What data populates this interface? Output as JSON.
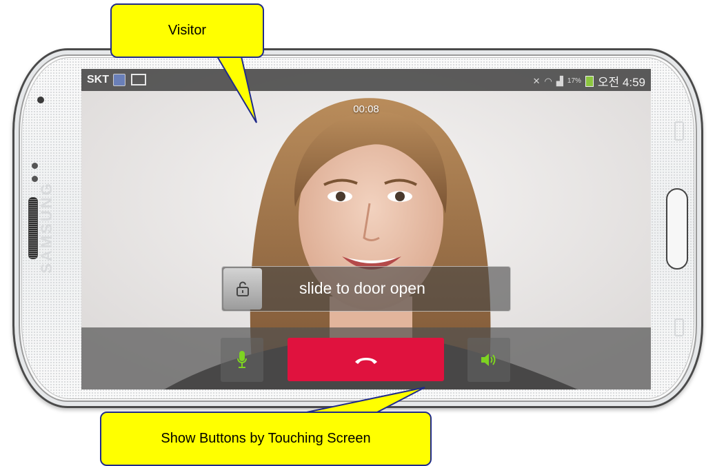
{
  "status_bar": {
    "carrier": "SKT",
    "battery_percent": "17%",
    "time": "오전 4:59",
    "icons": [
      "notification-icon",
      "gallery-icon",
      "mute-icon",
      "wifi-icon",
      "signal-icon",
      "battery-charging-icon"
    ]
  },
  "call": {
    "timer": "00:08",
    "slide_label": "slide to door open",
    "buttons": {
      "unlock_icon": "unlock-icon",
      "mic_icon": "microphone-icon",
      "end_call_icon": "end-call-icon",
      "speaker_icon": "speaker-icon"
    }
  },
  "device": {
    "brand": "SAMSUNG"
  },
  "callouts": {
    "visitor": "Visitor",
    "show_buttons": "Show Buttons by Touching Screen"
  },
  "colors": {
    "callout_fill": "#ffff00",
    "callout_border": "#1f2a8a",
    "end_call": "#e0123e",
    "icon_green": "#7ed321"
  }
}
